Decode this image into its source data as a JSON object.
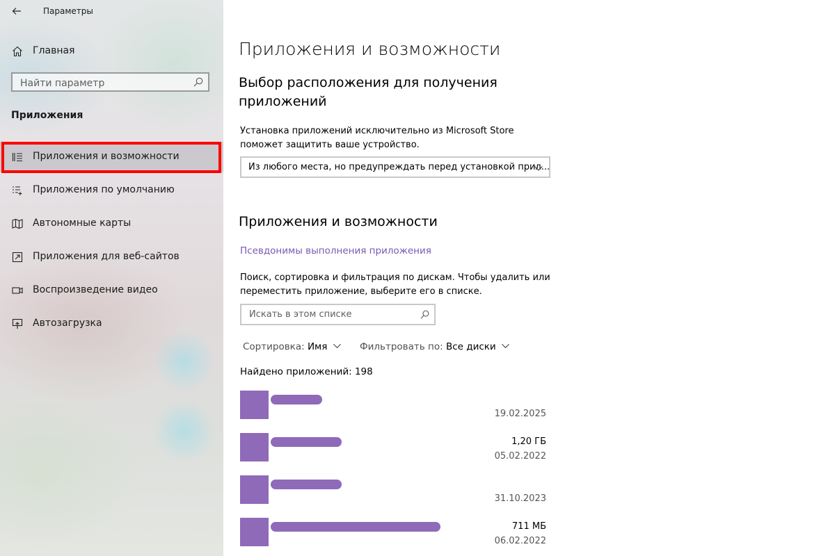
{
  "window": {
    "title": "Параметры"
  },
  "sidebar": {
    "home_label": "Главная",
    "search_placeholder": "Найти параметр",
    "section_title": "Приложения",
    "items": [
      {
        "label": "Приложения и возможности",
        "icon": "apps-features-icon",
        "selected": true
      },
      {
        "label": "Приложения по умолчанию",
        "icon": "default-apps-icon",
        "selected": false
      },
      {
        "label": "Автономные карты",
        "icon": "offline-maps-icon",
        "selected": false
      },
      {
        "label": "Приложения для веб-сайтов",
        "icon": "apps-for-websites-icon",
        "selected": false
      },
      {
        "label": "Воспроизведение видео",
        "icon": "video-playback-icon",
        "selected": false
      },
      {
        "label": "Автозагрузка",
        "icon": "startup-icon",
        "selected": false
      }
    ]
  },
  "main": {
    "title": "Приложения и возможности",
    "install_source": {
      "heading": "Выбор расположения для получения приложений",
      "description": "Установка приложений исключительно из Microsoft Store поможет защитить ваше устройство.",
      "selected_option": "Из любого места, но предупреждать перед установкой прил..."
    },
    "apps_section": {
      "heading": "Приложения и возможности",
      "aliases_link": "Псевдонимы выполнения приложения",
      "description": "Поиск, сортировка и фильтрация по дискам. Чтобы удалить или переместить приложение, выберите его в списке.",
      "search_placeholder": "Искать в этом списке",
      "sort_label": "Сортировка:",
      "sort_value": "Имя",
      "filter_label": "Фильтровать по:",
      "filter_value": "Все диски",
      "found_text": "Найдено приложений: 198",
      "apps": [
        {
          "size": "",
          "date": "19.02.2025",
          "name_redacted": true
        },
        {
          "size": "1,20 ГБ",
          "date": "05.02.2022",
          "name_redacted": true
        },
        {
          "size": "",
          "date": "31.10.2023",
          "name_redacted": true
        },
        {
          "size": "711 МБ",
          "date": "06.02.2022",
          "name_redacted": true
        }
      ]
    }
  },
  "colors": {
    "accent_link": "#7b59b3",
    "redaction": "#8f6ab9",
    "highlight_frame": "#ff0000"
  }
}
